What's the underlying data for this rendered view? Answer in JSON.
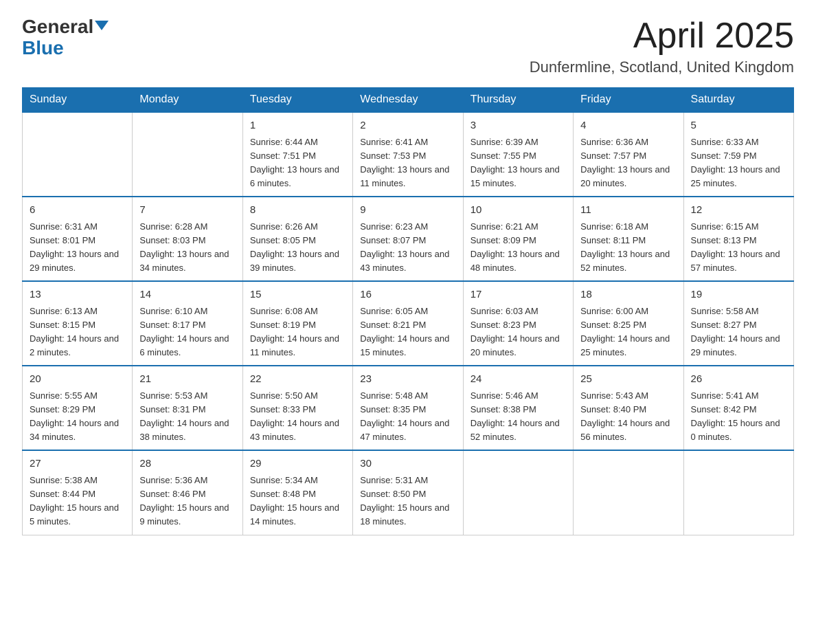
{
  "header": {
    "logo_general": "General",
    "logo_blue": "Blue",
    "month_title": "April 2025",
    "location": "Dunfermline, Scotland, United Kingdom"
  },
  "columns": [
    "Sunday",
    "Monday",
    "Tuesday",
    "Wednesday",
    "Thursday",
    "Friday",
    "Saturday"
  ],
  "weeks": [
    [
      {
        "day": "",
        "sunrise": "",
        "sunset": "",
        "daylight": ""
      },
      {
        "day": "",
        "sunrise": "",
        "sunset": "",
        "daylight": ""
      },
      {
        "day": "1",
        "sunrise": "Sunrise: 6:44 AM",
        "sunset": "Sunset: 7:51 PM",
        "daylight": "Daylight: 13 hours and 6 minutes."
      },
      {
        "day": "2",
        "sunrise": "Sunrise: 6:41 AM",
        "sunset": "Sunset: 7:53 PM",
        "daylight": "Daylight: 13 hours and 11 minutes."
      },
      {
        "day": "3",
        "sunrise": "Sunrise: 6:39 AM",
        "sunset": "Sunset: 7:55 PM",
        "daylight": "Daylight: 13 hours and 15 minutes."
      },
      {
        "day": "4",
        "sunrise": "Sunrise: 6:36 AM",
        "sunset": "Sunset: 7:57 PM",
        "daylight": "Daylight: 13 hours and 20 minutes."
      },
      {
        "day": "5",
        "sunrise": "Sunrise: 6:33 AM",
        "sunset": "Sunset: 7:59 PM",
        "daylight": "Daylight: 13 hours and 25 minutes."
      }
    ],
    [
      {
        "day": "6",
        "sunrise": "Sunrise: 6:31 AM",
        "sunset": "Sunset: 8:01 PM",
        "daylight": "Daylight: 13 hours and 29 minutes."
      },
      {
        "day": "7",
        "sunrise": "Sunrise: 6:28 AM",
        "sunset": "Sunset: 8:03 PM",
        "daylight": "Daylight: 13 hours and 34 minutes."
      },
      {
        "day": "8",
        "sunrise": "Sunrise: 6:26 AM",
        "sunset": "Sunset: 8:05 PM",
        "daylight": "Daylight: 13 hours and 39 minutes."
      },
      {
        "day": "9",
        "sunrise": "Sunrise: 6:23 AM",
        "sunset": "Sunset: 8:07 PM",
        "daylight": "Daylight: 13 hours and 43 minutes."
      },
      {
        "day": "10",
        "sunrise": "Sunrise: 6:21 AM",
        "sunset": "Sunset: 8:09 PM",
        "daylight": "Daylight: 13 hours and 48 minutes."
      },
      {
        "day": "11",
        "sunrise": "Sunrise: 6:18 AM",
        "sunset": "Sunset: 8:11 PM",
        "daylight": "Daylight: 13 hours and 52 minutes."
      },
      {
        "day": "12",
        "sunrise": "Sunrise: 6:15 AM",
        "sunset": "Sunset: 8:13 PM",
        "daylight": "Daylight: 13 hours and 57 minutes."
      }
    ],
    [
      {
        "day": "13",
        "sunrise": "Sunrise: 6:13 AM",
        "sunset": "Sunset: 8:15 PM",
        "daylight": "Daylight: 14 hours and 2 minutes."
      },
      {
        "day": "14",
        "sunrise": "Sunrise: 6:10 AM",
        "sunset": "Sunset: 8:17 PM",
        "daylight": "Daylight: 14 hours and 6 minutes."
      },
      {
        "day": "15",
        "sunrise": "Sunrise: 6:08 AM",
        "sunset": "Sunset: 8:19 PM",
        "daylight": "Daylight: 14 hours and 11 minutes."
      },
      {
        "day": "16",
        "sunrise": "Sunrise: 6:05 AM",
        "sunset": "Sunset: 8:21 PM",
        "daylight": "Daylight: 14 hours and 15 minutes."
      },
      {
        "day": "17",
        "sunrise": "Sunrise: 6:03 AM",
        "sunset": "Sunset: 8:23 PM",
        "daylight": "Daylight: 14 hours and 20 minutes."
      },
      {
        "day": "18",
        "sunrise": "Sunrise: 6:00 AM",
        "sunset": "Sunset: 8:25 PM",
        "daylight": "Daylight: 14 hours and 25 minutes."
      },
      {
        "day": "19",
        "sunrise": "Sunrise: 5:58 AM",
        "sunset": "Sunset: 8:27 PM",
        "daylight": "Daylight: 14 hours and 29 minutes."
      }
    ],
    [
      {
        "day": "20",
        "sunrise": "Sunrise: 5:55 AM",
        "sunset": "Sunset: 8:29 PM",
        "daylight": "Daylight: 14 hours and 34 minutes."
      },
      {
        "day": "21",
        "sunrise": "Sunrise: 5:53 AM",
        "sunset": "Sunset: 8:31 PM",
        "daylight": "Daylight: 14 hours and 38 minutes."
      },
      {
        "day": "22",
        "sunrise": "Sunrise: 5:50 AM",
        "sunset": "Sunset: 8:33 PM",
        "daylight": "Daylight: 14 hours and 43 minutes."
      },
      {
        "day": "23",
        "sunrise": "Sunrise: 5:48 AM",
        "sunset": "Sunset: 8:35 PM",
        "daylight": "Daylight: 14 hours and 47 minutes."
      },
      {
        "day": "24",
        "sunrise": "Sunrise: 5:46 AM",
        "sunset": "Sunset: 8:38 PM",
        "daylight": "Daylight: 14 hours and 52 minutes."
      },
      {
        "day": "25",
        "sunrise": "Sunrise: 5:43 AM",
        "sunset": "Sunset: 8:40 PM",
        "daylight": "Daylight: 14 hours and 56 minutes."
      },
      {
        "day": "26",
        "sunrise": "Sunrise: 5:41 AM",
        "sunset": "Sunset: 8:42 PM",
        "daylight": "Daylight: 15 hours and 0 minutes."
      }
    ],
    [
      {
        "day": "27",
        "sunrise": "Sunrise: 5:38 AM",
        "sunset": "Sunset: 8:44 PM",
        "daylight": "Daylight: 15 hours and 5 minutes."
      },
      {
        "day": "28",
        "sunrise": "Sunrise: 5:36 AM",
        "sunset": "Sunset: 8:46 PM",
        "daylight": "Daylight: 15 hours and 9 minutes."
      },
      {
        "day": "29",
        "sunrise": "Sunrise: 5:34 AM",
        "sunset": "Sunset: 8:48 PM",
        "daylight": "Daylight: 15 hours and 14 minutes."
      },
      {
        "day": "30",
        "sunrise": "Sunrise: 5:31 AM",
        "sunset": "Sunset: 8:50 PM",
        "daylight": "Daylight: 15 hours and 18 minutes."
      },
      {
        "day": "",
        "sunrise": "",
        "sunset": "",
        "daylight": ""
      },
      {
        "day": "",
        "sunrise": "",
        "sunset": "",
        "daylight": ""
      },
      {
        "day": "",
        "sunrise": "",
        "sunset": "",
        "daylight": ""
      }
    ]
  ]
}
